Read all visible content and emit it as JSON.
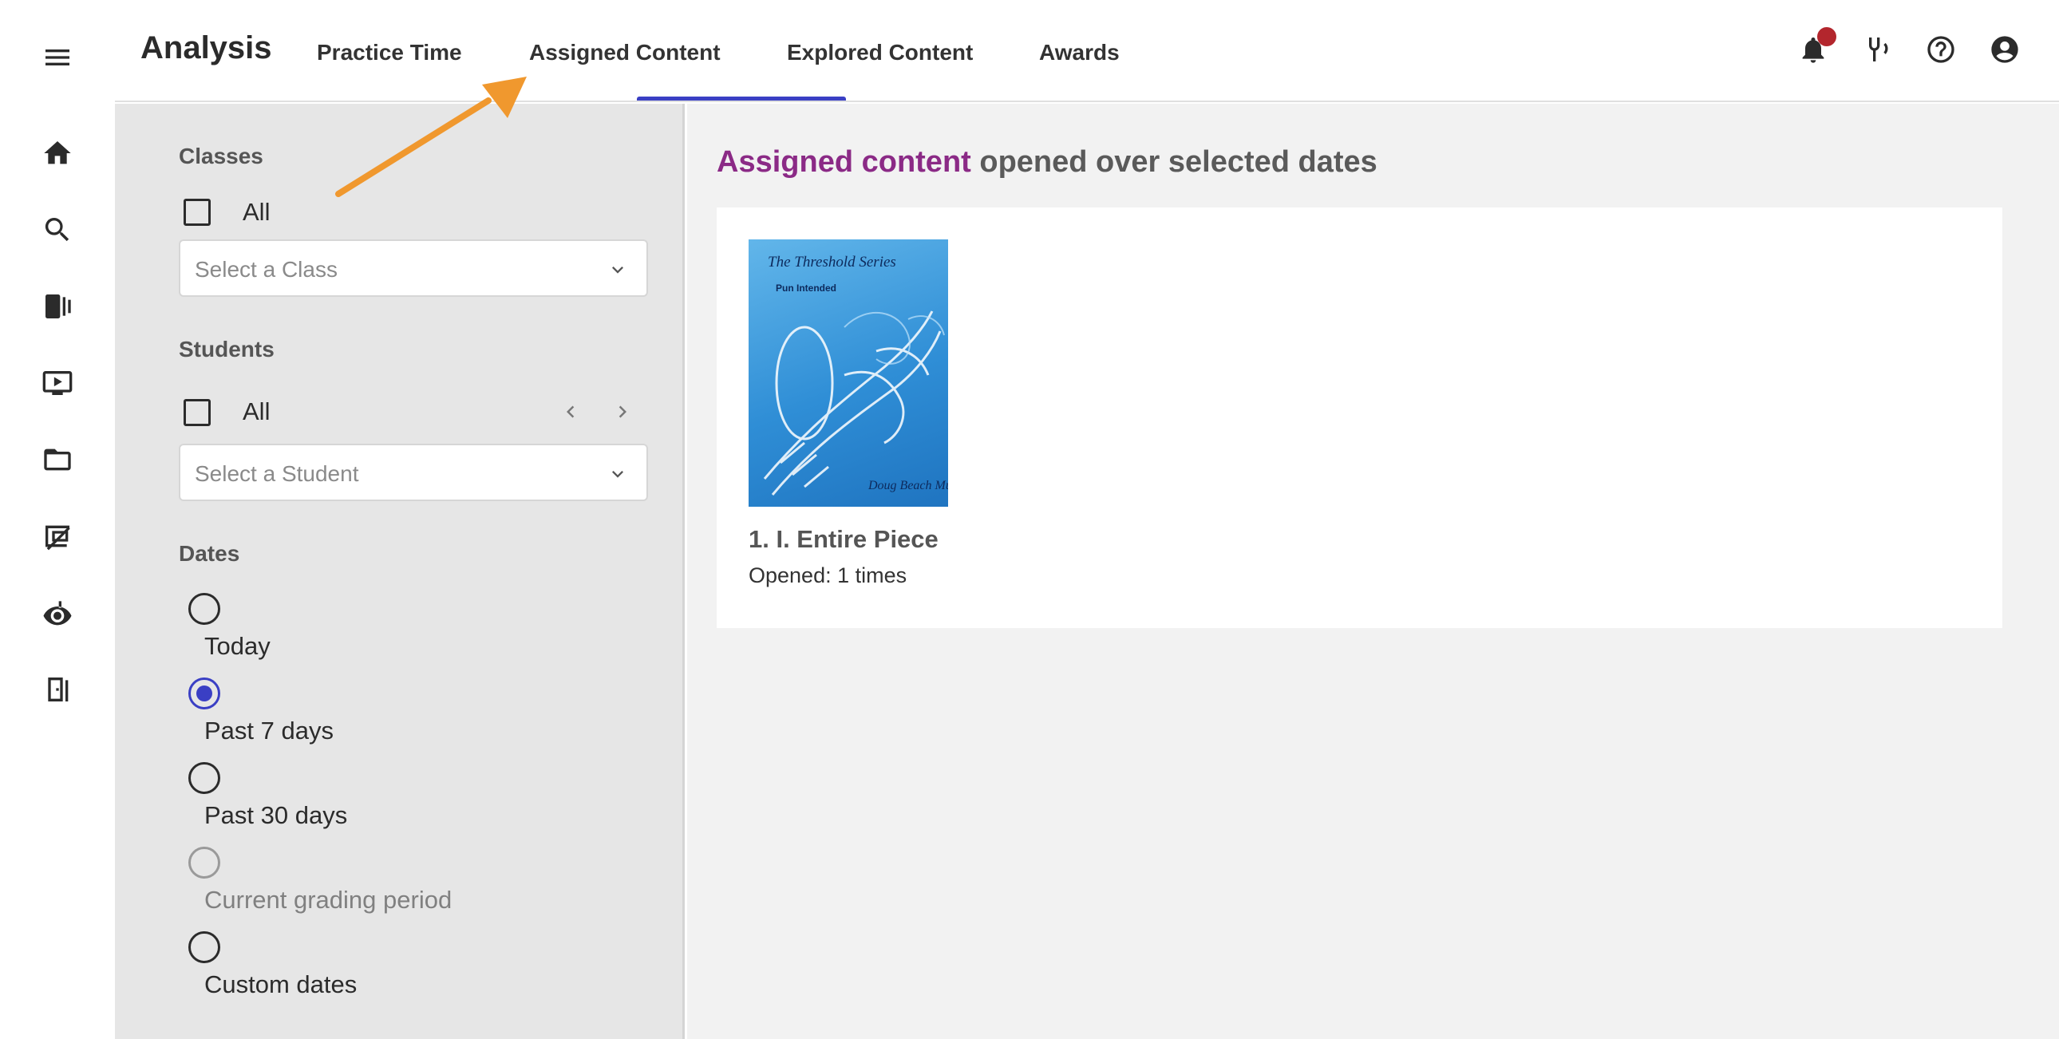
{
  "header": {
    "title": "Analysis",
    "tabs": [
      {
        "label": "Practice Time",
        "active": false
      },
      {
        "label": "Assigned Content",
        "active": true
      },
      {
        "label": "Explored Content",
        "active": false
      },
      {
        "label": "Awards",
        "active": false
      }
    ],
    "icons": [
      "notifications-icon",
      "tuner-icon",
      "help-icon",
      "account-icon"
    ],
    "has_notification": true
  },
  "rail": {
    "icons": [
      "menu-icon",
      "home-icon",
      "search-icon",
      "library-icon",
      "video-icon",
      "folder-icon",
      "assignments-icon",
      "ear-training-icon",
      "exit-icon"
    ]
  },
  "filters": {
    "classes": {
      "label": "Classes",
      "all_label": "All",
      "all_checked": false,
      "placeholder": "Select a Class"
    },
    "students": {
      "label": "Students",
      "all_label": "All",
      "all_checked": false,
      "placeholder": "Select a Student"
    },
    "dates": {
      "label": "Dates",
      "options": [
        {
          "label": "Today",
          "selected": false,
          "disabled": false
        },
        {
          "label": "Past 7 days",
          "selected": true,
          "disabled": false
        },
        {
          "label": "Past 30 days",
          "selected": false,
          "disabled": false
        },
        {
          "label": "Current grading period",
          "selected": false,
          "disabled": true
        },
        {
          "label": "Custom dates",
          "selected": false,
          "disabled": false
        }
      ]
    }
  },
  "main": {
    "heading_accent": "Assigned content",
    "heading_rest": "opened over selected dates",
    "items": [
      {
        "cover": {
          "series": "The Threshold Series",
          "title": "Pun Intended",
          "publisher": "Doug Beach Music"
        },
        "title": "1. I. Entire Piece",
        "opened_text": "Opened: 1 times"
      }
    ]
  },
  "colors": {
    "accent_purple": "#8b2a86",
    "active_tab": "#3a3fc4",
    "notification": "#b3262d",
    "annotation_arrow": "#f0982e"
  }
}
